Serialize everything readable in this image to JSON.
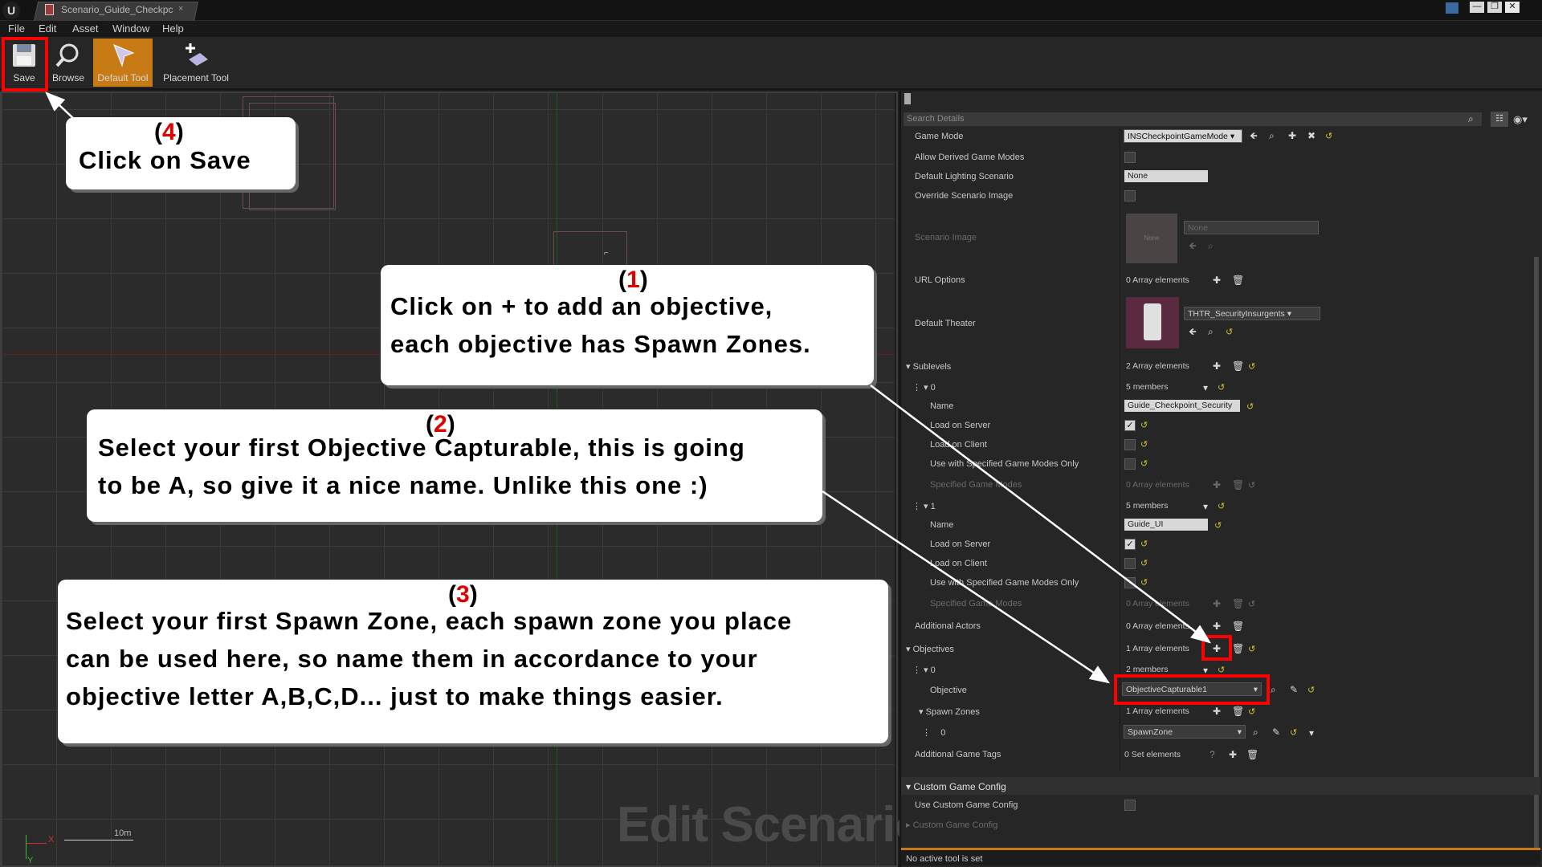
{
  "titlebar": {
    "logo": "U",
    "tab_label": "Scenario_Guide_Checkpc",
    "tab_close": "×",
    "window_buttons": [
      "—",
      "❐",
      "✕"
    ]
  },
  "menubar": {
    "items": [
      "File",
      "Edit",
      "Asset",
      "Window",
      "Help"
    ]
  },
  "toolbar": {
    "save_label": "Save",
    "browse_label": "Browse",
    "default_tool_label": "Default Tool",
    "placement_tool_label": "Placement Tool"
  },
  "viewport": {
    "watermark": "Edit Scenario",
    "scale_label": "10m",
    "axis_x": "X",
    "axis_y": "Y",
    "marker": "⌐"
  },
  "callouts": [
    {
      "num": "1",
      "text": "Click on + to add an objective,\neach objective has Spawn Zones."
    },
    {
      "num": "2",
      "text": "Select your first Objective Capturable, this is going\nto be A, so give it a nice name. Unlike this one :)"
    },
    {
      "num": "3",
      "text": "Select your first Spawn Zone, each spawn zone you place\ncan be used here, so name them in accordance to your\nobjective letter A,B,C,D... just to make things easier."
    },
    {
      "num": "4",
      "text": "Click on Save"
    }
  ],
  "details": {
    "search_placeholder": "Search Details",
    "rows": {
      "game_mode": {
        "label": "Game Mode",
        "value": "INSCheckpointGameMode"
      },
      "allow_derived": {
        "label": "Allow Derived Game Modes"
      },
      "default_lighting": {
        "label": "Default Lighting Scenario",
        "value": "None"
      },
      "override_image": {
        "label": "Override Scenario Image"
      },
      "scenario_image": {
        "label": "Scenario Image",
        "thumb": "None",
        "value": "None"
      },
      "url_options": {
        "label": "URL Options",
        "value": "0 Array elements"
      },
      "default_theater": {
        "label": "Default Theater",
        "value": "THTR_SecurityInsurgents"
      },
      "sublevels": {
        "label": "Sublevels",
        "value": "2 Array elements"
      },
      "sub0": {
        "label": "0",
        "value": "5 members"
      },
      "sub0_name": {
        "label": "Name",
        "value": "Guide_Checkpoint_Security"
      },
      "sub0_server": {
        "label": "Load on Server"
      },
      "sub0_client": {
        "label": "Load on Client"
      },
      "sub0_specified": {
        "label": "Use with Specified Game Modes Only"
      },
      "sub0_modes": {
        "label": "Specified Game Modes",
        "value": "0 Array elements"
      },
      "sub1": {
        "label": "1",
        "value": "5 members"
      },
      "sub1_name": {
        "label": "Name",
        "value": "Guide_UI"
      },
      "sub1_server": {
        "label": "Load on Server"
      },
      "sub1_client": {
        "label": "Load on Client"
      },
      "sub1_specified": {
        "label": "Use with Specified Game Modes Only"
      },
      "sub1_modes": {
        "label": "Specified Game Modes",
        "value": "0 Array elements"
      },
      "additional_actors": {
        "label": "Additional Actors",
        "value": "0 Array elements"
      },
      "objectives": {
        "label": "Objectives",
        "value": "1 Array elements"
      },
      "obj0": {
        "label": "0",
        "value": "2 members"
      },
      "objective": {
        "label": "Objective",
        "value": "ObjectiveCapturable1"
      },
      "spawn_zones": {
        "label": "Spawn Zones",
        "value": "1 Array elements"
      },
      "spawn0": {
        "label": "0",
        "value": "SpawnZone"
      },
      "game_tags": {
        "label": "Additional Game Tags",
        "value": "0 Set elements"
      }
    },
    "custom_section": "Custom Game Config",
    "use_custom": "Use Custom Game Config",
    "custom_config": "Custom Game Config"
  },
  "statusbar": {
    "text": "No active tool is set"
  },
  "colors": {
    "highlight": "#ff0000",
    "accent": "#c87a14",
    "callout_num": "#e00000"
  },
  "icons": [
    "save-icon",
    "browse-icon",
    "default-tool-icon",
    "placement-tool-icon",
    "search-icon",
    "plus-icon",
    "trash-icon",
    "reset-icon",
    "arrow-icon",
    "pick-icon",
    "clear-icon",
    "eye-icon"
  ]
}
